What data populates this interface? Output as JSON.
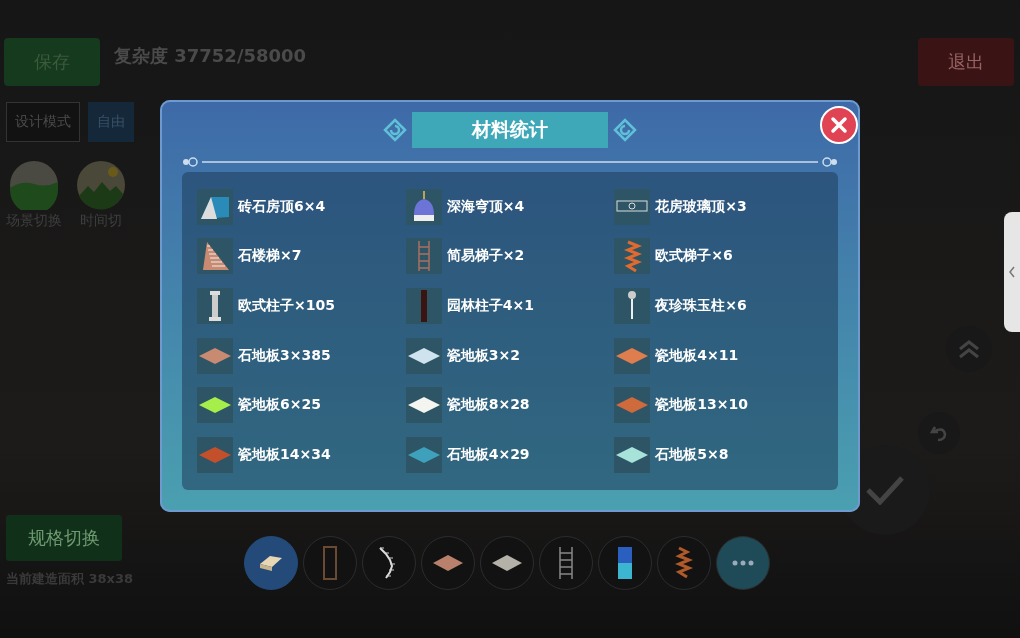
{
  "top_bar": {
    "save_button": "保存",
    "complexity": "复杂度 37752/58000",
    "exit_button": "退出"
  },
  "mode_tabs": [
    {
      "label": "设计模式",
      "selected": false
    },
    {
      "label": "自由",
      "selected": true
    }
  ],
  "scene_buttons": [
    {
      "label": "场景切换",
      "kind": "hills"
    },
    {
      "label": "时间切",
      "kind": "mountains"
    }
  ],
  "spec_button": "规格切换",
  "build_area": "当前建造面积 38x38",
  "toolbar": [
    {
      "kind": "eraser",
      "selected": true
    },
    {
      "kind": "door-frame",
      "selected": false
    },
    {
      "kind": "spiral-stairs",
      "selected": false
    },
    {
      "kind": "tile",
      "color": "#b9806c",
      "selected": false
    },
    {
      "kind": "tile",
      "color": "#b4b2a8",
      "selected": false
    },
    {
      "kind": "ladder",
      "selected": false
    },
    {
      "kind": "block",
      "selected": false
    },
    {
      "kind": "spiral-ladder",
      "selected": false
    },
    {
      "kind": "more",
      "selected": false
    }
  ],
  "dialog": {
    "title": "材料统计",
    "items": [
      {
        "label": "砖石房顶6×4",
        "kind": "roof"
      },
      {
        "label": "深海穹顶×4",
        "kind": "dome"
      },
      {
        "label": "花房玻璃顶×3",
        "kind": "glass-roof"
      },
      {
        "label": "石楼梯×7",
        "kind": "stairs"
      },
      {
        "label": "简易梯子×2",
        "kind": "ladder"
      },
      {
        "label": "欧式梯子×6",
        "kind": "spiral"
      },
      {
        "label": "欧式柱子×105",
        "kind": "column"
      },
      {
        "label": "园林柱子4×1",
        "kind": "pillar"
      },
      {
        "label": "夜珍珠玉柱×6",
        "kind": "lamp"
      },
      {
        "label": "石地板3×385",
        "kind": "tile",
        "color": "#c98a72"
      },
      {
        "label": "瓷地板3×2",
        "kind": "tile",
        "color": "#cfe3ee"
      },
      {
        "label": "瓷地板4×11",
        "kind": "tile",
        "color": "#e07d4f"
      },
      {
        "label": "瓷地板6×25",
        "kind": "tile",
        "color": "#a6ef4a"
      },
      {
        "label": "瓷地板8×28",
        "kind": "tile",
        "color": "#f4f4f0"
      },
      {
        "label": "瓷地板13×10",
        "kind": "tile",
        "color": "#cf6a3c"
      },
      {
        "label": "瓷地板14×34",
        "kind": "tile",
        "color": "#c3502a"
      },
      {
        "label": "石地板4×29",
        "kind": "tile",
        "color": "#3fa0bc"
      },
      {
        "label": "石地板5×8",
        "kind": "tile",
        "color": "#a8e3da"
      }
    ]
  }
}
